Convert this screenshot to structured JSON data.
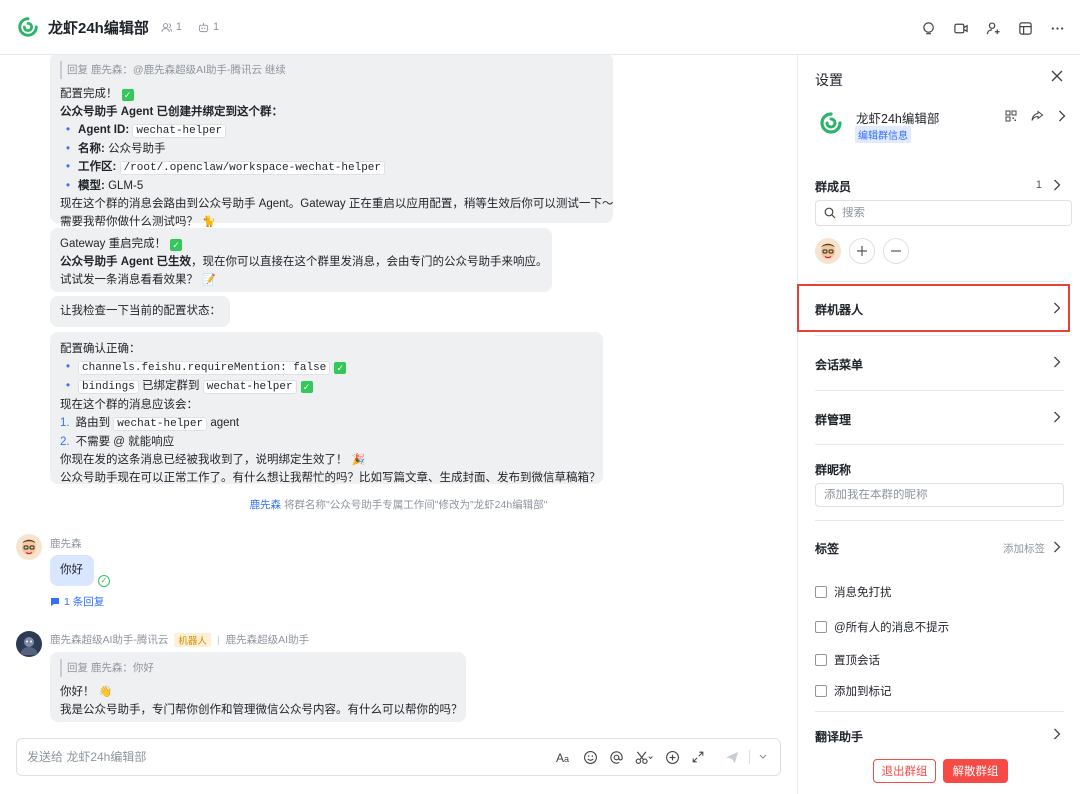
{
  "header": {
    "title": "龙虾24h编辑部",
    "member_count": "1",
    "bot_count": "1"
  },
  "messages": {
    "m1": {
      "quote": "回复 鹿先森：@鹿先森超级AI助手-腾讯云 继续",
      "l1": "配置完成！",
      "l2": "公众号助手 Agent 已创建并绑定到这个群：",
      "l3_label": "Agent ID",
      "l3_value": "wechat-helper",
      "l4_label": "名称",
      "l4_value": "公众号助手",
      "l5_label": "工作区",
      "l5_value": "/root/.openclaw/workspace-wechat-helper",
      "l6_label": "模型",
      "l6_value": "GLM-5",
      "l7": "现在这个群的消息会路由到公众号助手 Agent。Gateway 正在重启以应用配置，稍等生效后你可以测试一下～",
      "l8": "需要我帮你做什么测试吗？"
    },
    "m2": {
      "l1": "Gateway 重启完成！",
      "l2_bold": "公众号助手 Agent 已生效",
      "l2_rest": "，现在你可以直接在这个群里发消息，会由专门的公众号助手来响应。",
      "l3": "试试发一条消息看看效果？"
    },
    "m3": {
      "l1": "让我检查一下当前的配置状态："
    },
    "m4": {
      "l1": "配置确认正确：",
      "l2_code": "channels.feishu.requireMention: false",
      "l3_code": "bindings",
      "l3_text": "已绑定群到",
      "l3_code2": "wechat-helper",
      "l4": "现在这个群的消息应该会：",
      "l5_num": "1.",
      "l5_text": "路由到",
      "l5_code": "wechat-helper",
      "l5_tail": "agent",
      "l6_num": "2.",
      "l6_text": "不需要 @ 就能响应",
      "l7": "你现在发的这条消息已经被我收到了，说明绑定生效了！",
      "l8": "公众号助手现在可以正常工作了。有什么想让我帮忙的吗？比如写篇文章、生成封面、发布到微信草稿箱？"
    },
    "system_note_who": "鹿先森",
    "system_note_text": "将群名称\"公众号助手专属工作间\"修改为\"龙虾24h编辑部\"",
    "user_msg": {
      "sender": "鹿先森",
      "text": "你好",
      "reply_count": "1 条回复"
    },
    "bot_msg": {
      "sender": "鹿先森超级AI助手-腾讯云",
      "tag": "机器人",
      "sep": "|",
      "source": "鹿先森超级AI助手",
      "quote": "回复 鹿先森：你好",
      "l1": "你好！",
      "l2": "我是公众号助手，专门帮你创作和管理微信公众号内容。有什么可以帮你的吗？"
    }
  },
  "composer": {
    "placeholder": "发送给 龙虾24h编辑部"
  },
  "settings": {
    "title": "设置",
    "group_name": "龙虾24h编辑部",
    "edit_info": "编辑群信息",
    "members_label": "群成员",
    "members_count": "1",
    "search_placeholder": "搜索",
    "bots_label": "群机器人",
    "menu_label": "会话菜单",
    "manage_label": "群管理",
    "nickname_label": "群昵称",
    "nickname_placeholder": "添加我在本群的昵称",
    "tags_label": "标签",
    "add_tag": "添加标签",
    "opt_mute": "消息免打扰",
    "opt_at_all": "@所有人的消息不提示",
    "opt_pin": "置顶会话",
    "opt_mark": "添加到标记",
    "translate_label": "翻译助手",
    "exit_button": "退出群组",
    "dissolve_button": "解散群组"
  },
  "colors": {
    "accent": "#3370ff",
    "danger": "#f54a45",
    "highlight_box": "#e8413a",
    "success": "#34c759"
  }
}
